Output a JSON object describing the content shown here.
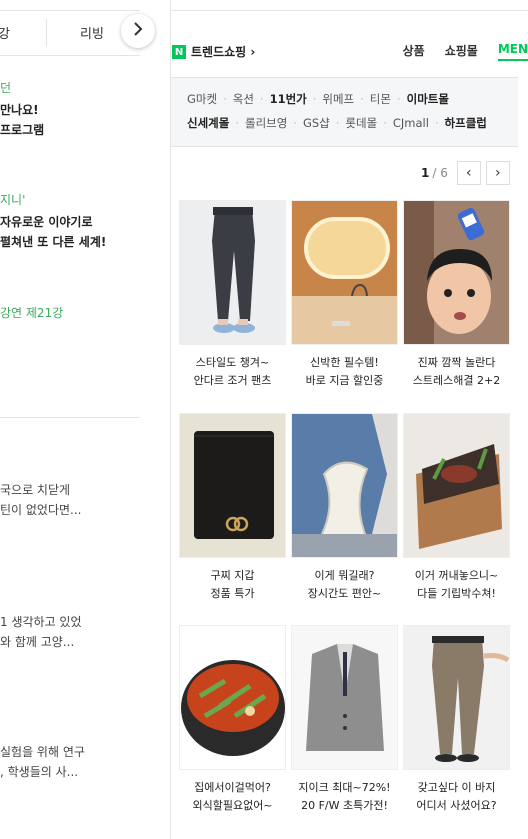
{
  "left": {
    "tab_partial": "강",
    "tab_review": "리빙",
    "scroll_icon": "chevron-right-icon",
    "items": [
      {
        "text": "던",
        "style": "g"
      },
      {
        "text": "만나요!",
        "style": "b"
      },
      {
        "text": "프로그램",
        "style": "b"
      },
      {
        "text": "지니'",
        "style": "g"
      },
      {
        "text": "자유로운 이야기로",
        "style": "b"
      },
      {
        "text": "펼쳐낸 또 다른 세계!",
        "style": "b"
      },
      {
        "text": "강연 제21강",
        "style": "g"
      },
      {
        "text": "국으로 치닫게",
        "style": "n"
      },
      {
        "text": "틴이 없었다면...",
        "style": "n"
      },
      {
        "text": "1 생각하고 있었",
        "style": "n"
      },
      {
        "text": "와 함께 고양...",
        "style": "n"
      },
      {
        "text": "실험을 위해 연구",
        "style": "n"
      },
      {
        "text": ", 학생들의 사...",
        "style": "n"
      }
    ]
  },
  "right": {
    "logo": "N",
    "title": "트렌드쇼핑 ›",
    "tabs": [
      "상품",
      "쇼핑몰",
      "MEN"
    ],
    "active_tab": "MEN",
    "stores_row1": [
      {
        "name": "G마켓",
        "bold": false
      },
      {
        "name": "옥션",
        "bold": false
      },
      {
        "name": "11번가",
        "bold": true
      },
      {
        "name": "위메프",
        "bold": false
      },
      {
        "name": "티몬",
        "bold": false
      },
      {
        "name": "이마트몰",
        "bold": true
      }
    ],
    "stores_row2": [
      {
        "name": "신세계몰",
        "bold": true
      },
      {
        "name": "롤리브영",
        "bold": false
      },
      {
        "name": "GS샵",
        "bold": false
      },
      {
        "name": "롯데몰",
        "bold": false
      },
      {
        "name": "CJmall",
        "bold": false
      },
      {
        "name": "하프클럽",
        "bold": true
      }
    ],
    "pager": {
      "current": "1",
      "total": "/ 6",
      "prev": "‹",
      "next": "›"
    },
    "products": [
      {
        "line1": "스타일도 챙겨~",
        "line2": "안다르 조거 팬츠",
        "image": "jogger-pants-photo"
      },
      {
        "line1": "신박한 필수템!",
        "line2": "바로 지금 할인중",
        "image": "led-mirror-photo"
      },
      {
        "line1": "진짜 깜짝 놀란다",
        "line2": "스트레스해결 2+2",
        "image": "man-with-can-photo"
      },
      {
        "line1": "구찌 지갑",
        "line2": "정품 특가",
        "image": "gucci-wallet-photo"
      },
      {
        "line1": "이게 뭐길래?",
        "line2": "장시간도 편안~",
        "image": "posture-chair-photo"
      },
      {
        "line1": "이거 꺼내놓으니~",
        "line2": "다들 기립박수쳐!",
        "image": "bbq-grill-photo"
      },
      {
        "line1": "집에서이걸먹어?",
        "line2": "외식할필요없어~",
        "image": "spicy-stew-photo"
      },
      {
        "line1": "지이크 최대~72%!",
        "line2": "20 F/W 초특가전!",
        "image": "blazer-photo"
      },
      {
        "line1": "갖고싶다 이 바지",
        "line2": "어디서 사셨어요?",
        "image": "slacks-photo"
      }
    ]
  }
}
